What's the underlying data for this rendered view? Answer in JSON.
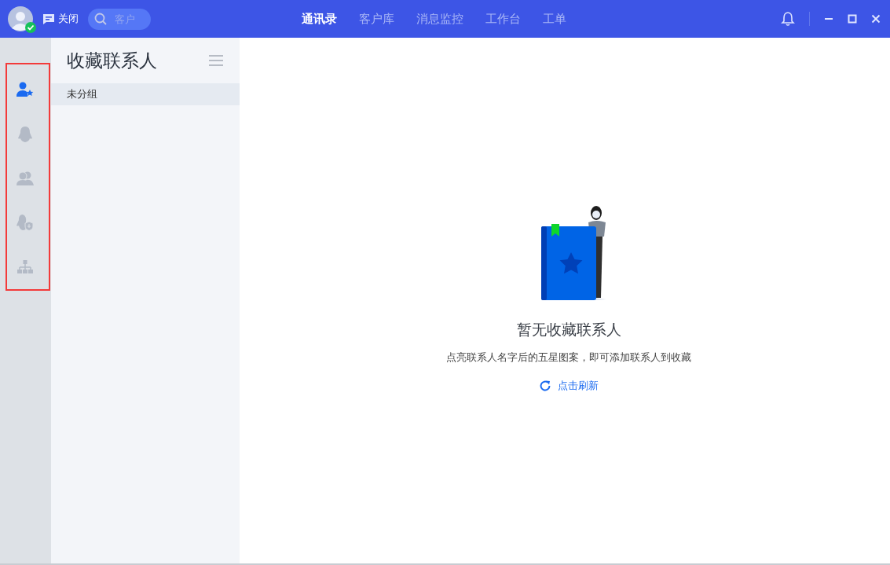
{
  "topbar": {
    "close_label": "关闭",
    "search": {
      "placeholder": "客户"
    },
    "nav": [
      {
        "label": "通讯录",
        "selected": true
      },
      {
        "label": "客户库",
        "selected": false
      },
      {
        "label": "消息监控",
        "selected": false
      },
      {
        "label": "工作台",
        "selected": false
      },
      {
        "label": "工单",
        "selected": false
      }
    ]
  },
  "rail": {
    "highlighted": true,
    "items": [
      {
        "kind": "favorite",
        "selected": true
      },
      {
        "kind": "penguin",
        "selected": false
      },
      {
        "kind": "group",
        "selected": false
      },
      {
        "kind": "enterprise",
        "selected": false
      },
      {
        "kind": "org",
        "selected": false
      }
    ]
  },
  "panel": {
    "title": "收藏联系人",
    "groups": [
      {
        "label": "未分组",
        "selected": true
      }
    ]
  },
  "empty_state": {
    "title": "暂无收藏联系人",
    "hint": "点亮联系人名字后的五星图案，即可添加联系人到收藏",
    "refresh_label": "点击刷新"
  }
}
